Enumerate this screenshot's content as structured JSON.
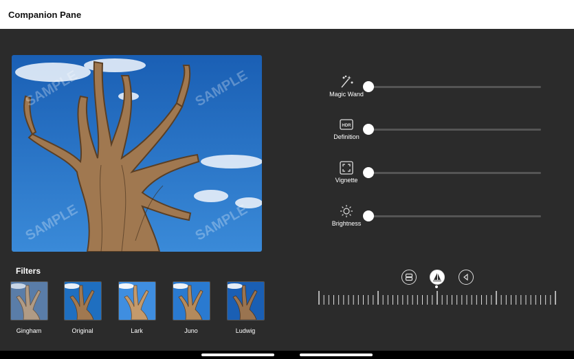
{
  "window": {
    "title": "Companion Pane"
  },
  "photo": {
    "watermark": "SAMPLE",
    "sky_color": "#1f6fc0"
  },
  "filters": {
    "heading": "Filters",
    "items": [
      {
        "label": "Gingham"
      },
      {
        "label": "Original"
      },
      {
        "label": "Lark"
      },
      {
        "label": "Juno"
      },
      {
        "label": "Ludwig"
      }
    ]
  },
  "adjustments": [
    {
      "label": "Magic Wand",
      "icon": "magic-wand-icon",
      "value": 0
    },
    {
      "label": "Definition",
      "icon": "hdr-icon",
      "value": 0,
      "icon_text": "HDR"
    },
    {
      "label": "Vignette",
      "icon": "vignette-icon",
      "value": 0
    },
    {
      "label": "Brightness",
      "icon": "sun-icon",
      "value": 0
    }
  ],
  "modes": [
    {
      "name": "crop-mode",
      "icon": "layers-icon",
      "active": false
    },
    {
      "name": "straighten-mode",
      "icon": "sailboat-icon",
      "active": true
    },
    {
      "name": "rotate-mode",
      "icon": "flip-icon",
      "active": false
    }
  ],
  "colors": {
    "background": "#2b2b2b",
    "titlebar": "#ffffff",
    "track": "#555555"
  }
}
